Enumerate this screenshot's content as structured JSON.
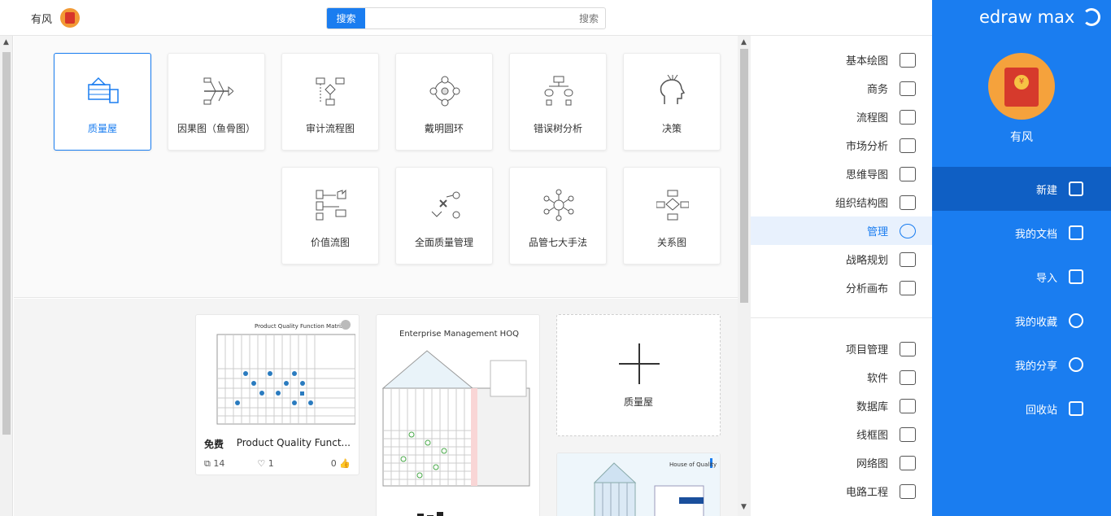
{
  "topbar": {
    "user_name": "有风",
    "search_button": "搜索",
    "search_placeholder": "搜索"
  },
  "categories": [
    {
      "label": "质量屋",
      "icon": "house-of-quality-icon",
      "selected": true
    },
    {
      "label": "因果图（鱼骨图）",
      "icon": "fishbone-icon"
    },
    {
      "label": "审计流程图",
      "icon": "audit-flowchart-icon"
    },
    {
      "label": "戴明圆环",
      "icon": "deming-cycle-icon"
    },
    {
      "label": "错误树分析",
      "icon": "fault-tree-icon"
    },
    {
      "label": "决策",
      "icon": "decision-head-icon"
    },
    {
      "label": "价值流图",
      "icon": "value-stream-icon"
    },
    {
      "label": "全面质量管理",
      "icon": "tqm-icon"
    },
    {
      "label": "品管七大手法",
      "icon": "seven-qc-tools-icon"
    },
    {
      "label": "关系图",
      "icon": "relationship-diagram-icon"
    }
  ],
  "templates": {
    "new_label": "质量屋",
    "card1": {
      "title": "Product Quality Funct...",
      "badge": "免费",
      "preview_title": "Product Quality Function Matrix",
      "likes": "0",
      "favorites": "1",
      "copies": "14"
    },
    "card2": {
      "preview_title": "Enterprise Management HOQ"
    },
    "card3": {
      "preview_title": "House of Quality"
    }
  },
  "menu": {
    "items": [
      {
        "label": "基本绘图",
        "icon": "basic-drawing-icon"
      },
      {
        "label": "商务",
        "icon": "briefcase-icon"
      },
      {
        "label": "流程图",
        "icon": "flowchart-icon"
      },
      {
        "label": "市场分析",
        "icon": "bar-chart-icon"
      },
      {
        "label": "思维导图",
        "icon": "mindmap-icon"
      },
      {
        "label": "组织结构图",
        "icon": "org-chart-icon"
      },
      {
        "label": "管理",
        "icon": "management-gear-icon",
        "active": true
      },
      {
        "label": "战略规划",
        "icon": "strategy-icon"
      },
      {
        "label": "分析画布",
        "icon": "canvas-icon"
      },
      {
        "label": "项目管理",
        "icon": "project-icon"
      },
      {
        "label": "软件",
        "icon": "software-icon"
      },
      {
        "label": "数据库",
        "icon": "database-icon"
      },
      {
        "label": "线框图",
        "icon": "wireframe-icon"
      },
      {
        "label": "网络图",
        "icon": "network-icon"
      },
      {
        "label": "电路工程",
        "icon": "circuit-icon"
      }
    ]
  },
  "nav": {
    "logo": "edraw max",
    "user_name": "有风",
    "items": [
      {
        "label": "新建",
        "icon": "new-icon",
        "active": true
      },
      {
        "label": "我的文档",
        "icon": "documents-icon"
      },
      {
        "label": "导入",
        "icon": "import-icon"
      },
      {
        "label": "我的收藏",
        "icon": "star-icon"
      },
      {
        "label": "我的分享",
        "icon": "share-icon"
      },
      {
        "label": "回收站",
        "icon": "trash-icon"
      }
    ]
  },
  "colors": {
    "accent": "#1a7df0",
    "accent_dark": "#0f5fc4"
  }
}
